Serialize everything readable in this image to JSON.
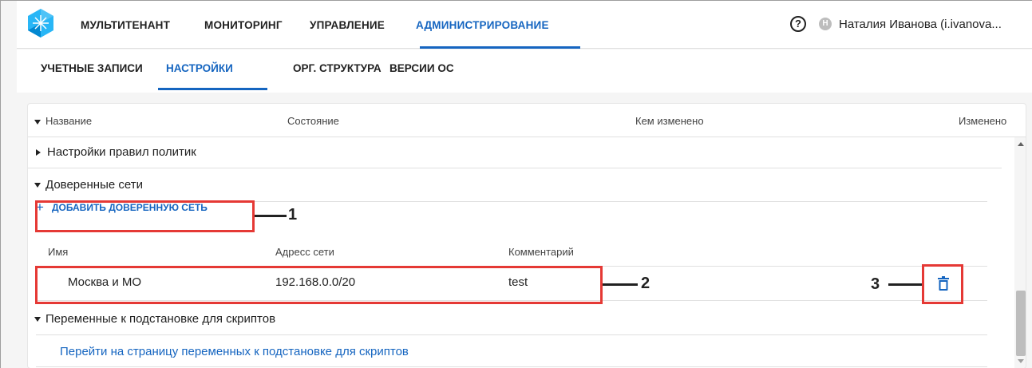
{
  "topnav": {
    "items": [
      "МУЛЬТИТЕНАНТ",
      "МОНИТОРИНГ",
      "УПРАВЛЕНИЕ",
      "АДМИНИСТРИРОВАНИЕ"
    ],
    "active_index": 3,
    "help_symbol": "?",
    "avatar_initial": "Н",
    "user_name": "Наталия Иванова (i.ivanova..."
  },
  "subnav": {
    "items": [
      "УЧЕТНЫЕ ЗАПИСИ",
      "НАСТРОЙКИ",
      "ОРГ. СТРУКТУРА",
      "ВЕРСИИ ОС"
    ],
    "active_index": 1
  },
  "table": {
    "columns": [
      "Название",
      "Состояние",
      "Кем изменено",
      "Изменено"
    ],
    "groups": [
      {
        "label": "Настройки правил политик",
        "expanded": false
      },
      {
        "label": "Доверенные сети",
        "expanded": true
      },
      {
        "label": "Переменные к подстановке для скриптов",
        "expanded": true
      }
    ]
  },
  "trusted_networks": {
    "add_button_label": "ДОБАВИТЬ ДОВЕРЕННУЮ СЕТЬ",
    "add_symbol": "+",
    "columns": [
      "Имя",
      "Адресс сети",
      "Комментарий"
    ],
    "rows": [
      {
        "name": "Москва и МО",
        "address": "192.168.0.0/20",
        "comment": "test"
      }
    ]
  },
  "script_variables": {
    "link_text": "Перейти на страницу переменных к подстановке для скриптов"
  },
  "annotations": [
    "1",
    "2",
    "3"
  ],
  "colors": {
    "accent": "#1565c0",
    "callout": "#e53935"
  }
}
